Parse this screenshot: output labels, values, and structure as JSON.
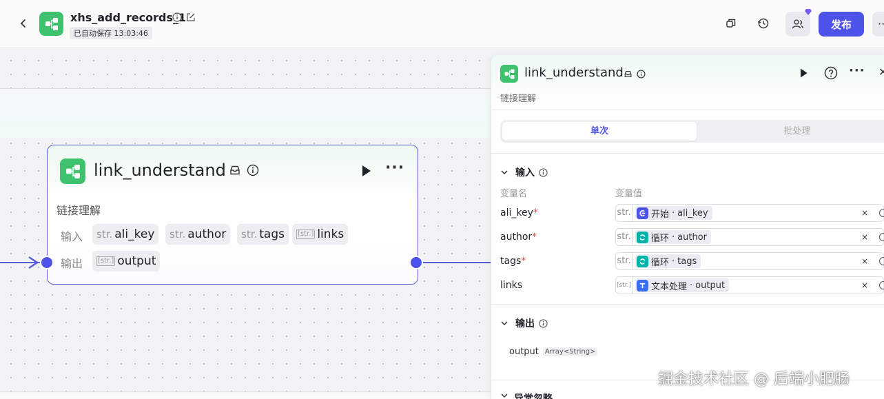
{
  "header": {
    "title": "xhs_add_records_1",
    "saved_text": "已自动保存 13:03:46",
    "publish_label": "发布"
  },
  "node": {
    "title": "link_understand",
    "description": "链接理解",
    "inputs_label": "输入",
    "outputs_label": "输出",
    "inputs": [
      {
        "type": "str.",
        "name": "ali_key"
      },
      {
        "type": "str.",
        "name": "author"
      },
      {
        "type": "str.",
        "name": "tags"
      },
      {
        "type": "[str.]",
        "name": "links"
      }
    ],
    "outputs": [
      {
        "type": "[str.]",
        "name": "output"
      }
    ]
  },
  "panel": {
    "title": "link_understand",
    "description": "链接理解",
    "tabs": [
      "单次",
      "批处理"
    ],
    "input_section": "输入",
    "col_name": "变量名",
    "col_value": "变量值",
    "variables": [
      {
        "name": "ali_key",
        "required": "*",
        "type": "str.",
        "source": "开始",
        "ref": "ali_key",
        "icon_color": "#4d53e8"
      },
      {
        "name": "author",
        "required": "*",
        "type": "str.",
        "source": "循环",
        "ref": "author",
        "icon_color": "#00b2a8"
      },
      {
        "name": "tags",
        "required": "*",
        "type": "str.",
        "source": "循环",
        "ref": "tags",
        "icon_color": "#00b2a8"
      },
      {
        "name": "links",
        "required": "",
        "type": "[str.]",
        "source": "文本处理",
        "ref": "output",
        "icon_color": "#3b6ef5"
      }
    ],
    "output_section": "输出",
    "output_name": "output",
    "output_type": "Array<String>",
    "error_section": "异常忽略"
  },
  "watermark": "掘金技术社区 @ 后端小肥肠"
}
